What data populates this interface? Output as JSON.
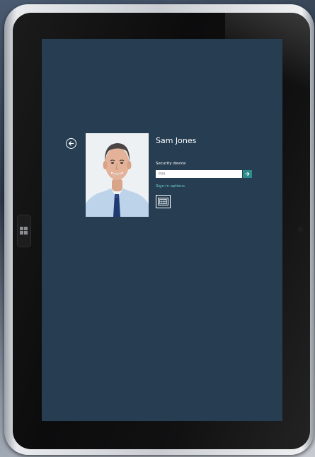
{
  "login": {
    "user_name": "Sam Jones",
    "security_label": "Security device",
    "pin_placeholder": "PIN",
    "signin_options": "Sign-in options"
  },
  "icons": {
    "back": "back-arrow-icon",
    "submit": "arrow-right-icon",
    "signin_method": "smart-card-icon",
    "windows": "windows-logo-icon"
  },
  "colors": {
    "screen_background": "#263d52",
    "accent": "#2e8c8c",
    "link": "#6fd0cf",
    "text": "#ffffff"
  }
}
